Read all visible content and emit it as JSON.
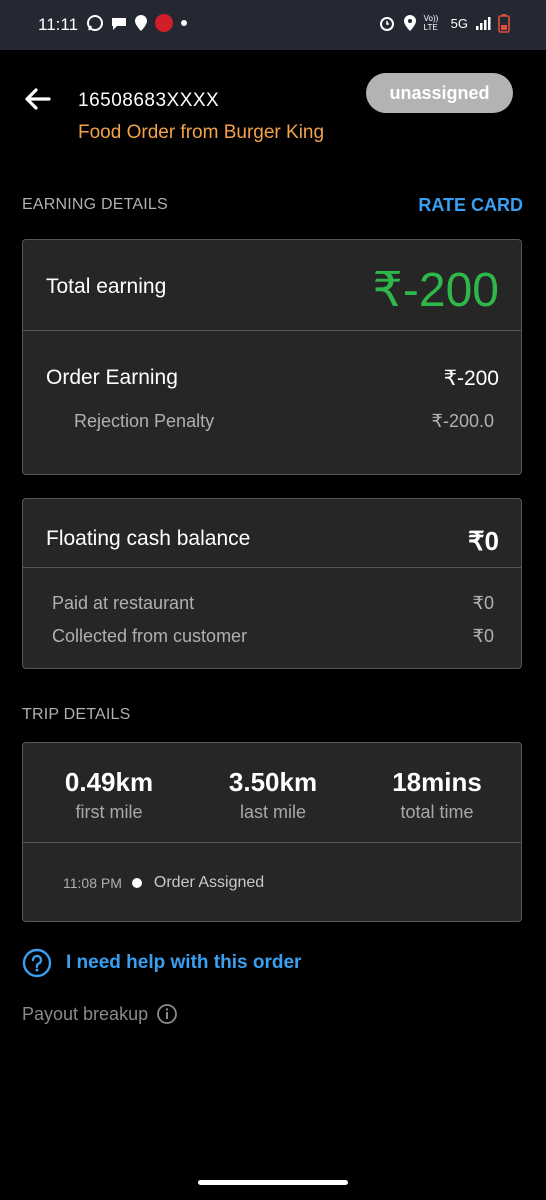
{
  "status_bar": {
    "time": "11:11",
    "network": "5G",
    "volte": "Vo)) LTE"
  },
  "header": {
    "order_id": "16508683XXXX",
    "order_subtitle": "Food Order from Burger King",
    "status": "unassigned"
  },
  "earning_section": {
    "label": "EARNING DETAILS",
    "rate_card": "RATE CARD",
    "total_label": "Total earning",
    "total_value": "₹-200",
    "order_earning_label": "Order Earning",
    "order_earning_value": "₹-200",
    "penalty_label": "Rejection Penalty",
    "penalty_value": "₹-200.0"
  },
  "floating_cash": {
    "label": "Floating cash balance",
    "value": "₹0",
    "paid_label": "Paid at restaurant",
    "paid_value": "₹0",
    "collected_label": "Collected from customer",
    "collected_value": "₹0"
  },
  "trip_section": {
    "label": "TRIP DETAILS",
    "stats": [
      {
        "value": "0.49km",
        "label": "first mile"
      },
      {
        "value": "3.50km",
        "label": "last mile"
      },
      {
        "value": "18mins",
        "label": "total time"
      }
    ],
    "timeline": [
      {
        "time": "11:08 PM",
        "event": "Order Assigned"
      }
    ]
  },
  "help": {
    "text": "I need help with this order"
  },
  "payout": {
    "text": "Payout breakup"
  },
  "colors": {
    "accent_blue": "#3a9ff0",
    "accent_orange": "#f2a24a",
    "earning_green": "#2fb84a",
    "pill_gray": "#b3b3b3"
  }
}
